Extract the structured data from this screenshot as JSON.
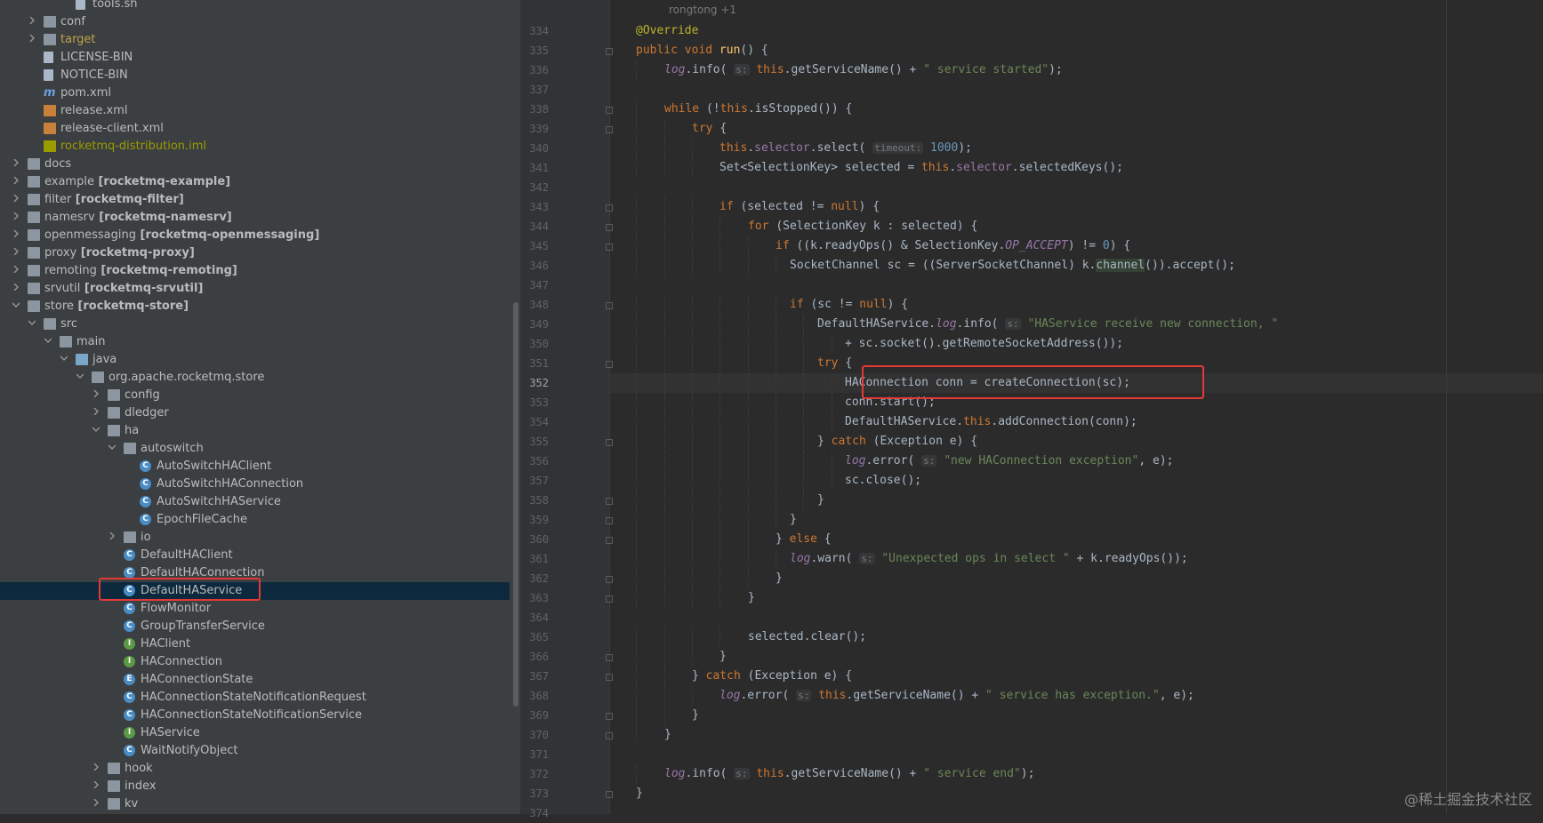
{
  "tree": [
    {
      "label": "tools.sh",
      "icon": "file-icon",
      "indent": 4,
      "arrow": "none"
    },
    {
      "label": "conf",
      "icon": "folder-icon",
      "indent": 2,
      "arrow": "collapsed"
    },
    {
      "label": "target",
      "icon": "folder-icon",
      "indent": 2,
      "arrow": "collapsed",
      "color": "orange"
    },
    {
      "label": "LICENSE-BIN",
      "icon": "file-icon",
      "indent": 2,
      "arrow": "none"
    },
    {
      "label": "NOTICE-BIN",
      "icon": "file-icon",
      "indent": 2,
      "arrow": "none"
    },
    {
      "label": "pom.xml",
      "icon": "maven-icon",
      "indent": 2,
      "arrow": "none"
    },
    {
      "label": "release.xml",
      "icon": "xml-icon",
      "indent": 2,
      "arrow": "none"
    },
    {
      "label": "release-client.xml",
      "icon": "xml-icon",
      "indent": 2,
      "arrow": "none"
    },
    {
      "label": "rocketmq-distribution.iml",
      "icon": "iml-icon",
      "indent": 2,
      "arrow": "none",
      "color": "olive"
    },
    {
      "label": "docs",
      "icon": "folder-icon",
      "indent": 1,
      "arrow": "collapsed"
    },
    {
      "label": "example",
      "module": "[rocketmq-example]",
      "icon": "module-folder-icon",
      "indent": 1,
      "arrow": "collapsed"
    },
    {
      "label": "filter",
      "module": "[rocketmq-filter]",
      "icon": "module-folder-icon",
      "indent": 1,
      "arrow": "collapsed"
    },
    {
      "label": "namesrv",
      "module": "[rocketmq-namesrv]",
      "icon": "module-folder-icon",
      "indent": 1,
      "arrow": "collapsed"
    },
    {
      "label": "openmessaging",
      "module": "[rocketmq-openmessaging]",
      "icon": "module-folder-icon",
      "indent": 1,
      "arrow": "collapsed"
    },
    {
      "label": "proxy",
      "module": "[rocketmq-proxy]",
      "icon": "module-folder-icon",
      "indent": 1,
      "arrow": "collapsed"
    },
    {
      "label": "remoting",
      "module": "[rocketmq-remoting]",
      "icon": "module-folder-icon",
      "indent": 1,
      "arrow": "collapsed"
    },
    {
      "label": "srvutil",
      "module": "[rocketmq-srvutil]",
      "icon": "module-folder-icon",
      "indent": 1,
      "arrow": "collapsed"
    },
    {
      "label": "store",
      "module": "[rocketmq-store]",
      "icon": "module-folder-icon",
      "indent": 1,
      "arrow": "expanded"
    },
    {
      "label": "src",
      "icon": "folder-icon",
      "indent": 2,
      "arrow": "expanded"
    },
    {
      "label": "main",
      "icon": "folder-icon",
      "indent": 3,
      "arrow": "expanded"
    },
    {
      "label": "java",
      "icon": "source-folder-icon",
      "indent": 4,
      "arrow": "expanded"
    },
    {
      "label": "org.apache.rocketmq.store",
      "icon": "package-icon",
      "indent": 5,
      "arrow": "expanded"
    },
    {
      "label": "config",
      "icon": "package-icon",
      "indent": 6,
      "arrow": "collapsed"
    },
    {
      "label": "dledger",
      "icon": "package-icon",
      "indent": 6,
      "arrow": "collapsed"
    },
    {
      "label": "ha",
      "icon": "package-icon",
      "indent": 6,
      "arrow": "expanded"
    },
    {
      "label": "autoswitch",
      "icon": "package-icon",
      "indent": 7,
      "arrow": "expanded"
    },
    {
      "label": "AutoSwitchHAClient",
      "icon": "class-icon",
      "indent": 8,
      "arrow": "none"
    },
    {
      "label": "AutoSwitchHAConnection",
      "icon": "class-icon",
      "indent": 8,
      "arrow": "none"
    },
    {
      "label": "AutoSwitchHAService",
      "icon": "class-icon",
      "indent": 8,
      "arrow": "none"
    },
    {
      "label": "EpochFileCache",
      "icon": "class-icon",
      "indent": 8,
      "arrow": "none"
    },
    {
      "label": "io",
      "icon": "package-icon",
      "indent": 7,
      "arrow": "collapsed"
    },
    {
      "label": "DefaultHAClient",
      "icon": "class-icon",
      "indent": 7,
      "arrow": "none"
    },
    {
      "label": "DefaultHAConnection",
      "icon": "class-icon",
      "indent": 7,
      "arrow": "none"
    },
    {
      "label": "DefaultHAService",
      "icon": "class-icon",
      "indent": 7,
      "arrow": "none",
      "selected": true
    },
    {
      "label": "FlowMonitor",
      "icon": "class-icon",
      "indent": 7,
      "arrow": "none"
    },
    {
      "label": "GroupTransferService",
      "icon": "class-icon",
      "indent": 7,
      "arrow": "none"
    },
    {
      "label": "HAClient",
      "icon": "interface-icon",
      "indent": 7,
      "arrow": "none"
    },
    {
      "label": "HAConnection",
      "icon": "interface-icon",
      "indent": 7,
      "arrow": "none"
    },
    {
      "label": "HAConnectionState",
      "icon": "enum-icon",
      "indent": 7,
      "arrow": "none"
    },
    {
      "label": "HAConnectionStateNotificationRequest",
      "icon": "class-icon",
      "indent": 7,
      "arrow": "none"
    },
    {
      "label": "HAConnectionStateNotificationService",
      "icon": "class-icon",
      "indent": 7,
      "arrow": "none"
    },
    {
      "label": "HAService",
      "icon": "interface-icon",
      "indent": 7,
      "arrow": "none"
    },
    {
      "label": "WaitNotifyObject",
      "icon": "class-icon",
      "indent": 7,
      "arrow": "none"
    },
    {
      "label": "hook",
      "icon": "package-icon",
      "indent": 6,
      "arrow": "collapsed"
    },
    {
      "label": "index",
      "icon": "package-icon",
      "indent": 6,
      "arrow": "collapsed"
    },
    {
      "label": "kv",
      "icon": "package-icon",
      "indent": 6,
      "arrow": "collapsed"
    }
  ],
  "editor": {
    "author_hint": "rongtong +1",
    "current_line": 352,
    "lines": [
      {
        "n": 334,
        "indent": 1,
        "t": [
          {
            "c": "ann",
            "s": "@Override"
          }
        ]
      },
      {
        "n": 335,
        "indent": 1,
        "t": [
          {
            "c": "kw",
            "s": "public void "
          },
          {
            "c": "fn",
            "s": "run"
          },
          {
            "s": "() {"
          }
        ]
      },
      {
        "n": 336,
        "indent": 2,
        "t": [
          {
            "c": "ifield",
            "s": "log"
          },
          {
            "s": ".info( "
          },
          {
            "c": "hint",
            "s": "s:"
          },
          {
            "s": " "
          },
          {
            "c": "kw",
            "s": "this"
          },
          {
            "s": ".getServiceName() + "
          },
          {
            "c": "str",
            "s": "\" service started\""
          },
          {
            "s": ");"
          }
        ]
      },
      {
        "n": 337,
        "indent": 0,
        "t": []
      },
      {
        "n": 338,
        "indent": 2,
        "t": [
          {
            "c": "kw",
            "s": "while "
          },
          {
            "s": "(!"
          },
          {
            "c": "kw",
            "s": "this"
          },
          {
            "s": ".isStopped()) {"
          }
        ]
      },
      {
        "n": 339,
        "indent": 3,
        "t": [
          {
            "c": "kw",
            "s": "try "
          },
          {
            "s": "{"
          }
        ]
      },
      {
        "n": 340,
        "indent": 4,
        "t": [
          {
            "c": "kw",
            "s": "this"
          },
          {
            "s": "."
          },
          {
            "c": "field",
            "s": "selector"
          },
          {
            "s": ".select( "
          },
          {
            "c": "hint",
            "s": "timeout:"
          },
          {
            "s": " "
          },
          {
            "c": "num",
            "s": "1000"
          },
          {
            "s": ");"
          }
        ]
      },
      {
        "n": 341,
        "indent": 4,
        "t": [
          {
            "s": "Set<SelectionKey> selected = "
          },
          {
            "c": "kw",
            "s": "this"
          },
          {
            "s": "."
          },
          {
            "c": "field",
            "s": "selector"
          },
          {
            "s": ".selectedKeys();"
          }
        ]
      },
      {
        "n": 342,
        "indent": 0,
        "t": []
      },
      {
        "n": 343,
        "indent": 4,
        "t": [
          {
            "c": "kw",
            "s": "if "
          },
          {
            "s": "(selected != "
          },
          {
            "c": "kw",
            "s": "null"
          },
          {
            "s": ") {"
          }
        ]
      },
      {
        "n": 344,
        "indent": 5,
        "t": [
          {
            "c": "kw",
            "s": "for "
          },
          {
            "s": "(SelectionKey k : selected) {"
          }
        ]
      },
      {
        "n": 345,
        "indent": 6,
        "t": [
          {
            "c": "kw",
            "s": "if "
          },
          {
            "s": "((k.readyOps() & SelectionKey."
          },
          {
            "c": "ifield",
            "s": "OP_ACCEPT"
          },
          {
            "s": ") != "
          },
          {
            "c": "num",
            "s": "0"
          },
          {
            "s": ") {"
          }
        ]
      },
      {
        "n": 346,
        "indent": 6,
        "extra": 1,
        "t": [
          {
            "s": "SocketChannel sc = ((ServerSocketChannel) k."
          },
          {
            "c": "hl",
            "s": "channel"
          },
          {
            "s": "()).accept();"
          }
        ]
      },
      {
        "n": 347,
        "indent": 0,
        "t": []
      },
      {
        "n": 348,
        "indent": 6,
        "extra": 1,
        "t": [
          {
            "c": "kw",
            "s": "if "
          },
          {
            "s": "(sc != "
          },
          {
            "c": "kw",
            "s": "null"
          },
          {
            "s": ") {"
          }
        ]
      },
      {
        "n": 349,
        "indent": 7,
        "extra": 1,
        "t": [
          {
            "s": "DefaultHAService."
          },
          {
            "c": "ifield",
            "s": "log"
          },
          {
            "s": ".info( "
          },
          {
            "c": "hint",
            "s": "s:"
          },
          {
            "s": " "
          },
          {
            "c": "str",
            "s": "\"HAService receive new connection, \""
          }
        ]
      },
      {
        "n": 350,
        "indent": 8,
        "extra": 1,
        "t": [
          {
            "s": "+ sc.socket().getRemoteSocketAddress());"
          }
        ]
      },
      {
        "n": 351,
        "indent": 7,
        "extra": 1,
        "t": [
          {
            "c": "kw",
            "s": "try "
          },
          {
            "s": "{"
          }
        ]
      },
      {
        "n": 352,
        "indent": 8,
        "extra": 1,
        "t": [
          {
            "s": "HAConnection conn = createConnection(sc);"
          }
        ]
      },
      {
        "n": 353,
        "indent": 8,
        "extra": 1,
        "t": [
          {
            "s": "conn.start();"
          }
        ]
      },
      {
        "n": 354,
        "indent": 8,
        "extra": 1,
        "t": [
          {
            "s": "DefaultHAService."
          },
          {
            "c": "kw",
            "s": "this"
          },
          {
            "s": ".addConnection(conn);"
          }
        ]
      },
      {
        "n": 355,
        "indent": 7,
        "extra": 1,
        "t": [
          {
            "s": "} "
          },
          {
            "c": "kw",
            "s": "catch "
          },
          {
            "s": "(Exception e) {"
          }
        ]
      },
      {
        "n": 356,
        "indent": 8,
        "extra": 1,
        "t": [
          {
            "c": "ifield",
            "s": "log"
          },
          {
            "s": ".error( "
          },
          {
            "c": "hint",
            "s": "s:"
          },
          {
            "s": " "
          },
          {
            "c": "str",
            "s": "\"new HAConnection exception\""
          },
          {
            "s": ", e);"
          }
        ]
      },
      {
        "n": 357,
        "indent": 8,
        "extra": 1,
        "t": [
          {
            "s": "sc.close();"
          }
        ]
      },
      {
        "n": 358,
        "indent": 7,
        "extra": 1,
        "t": [
          {
            "s": "}"
          }
        ]
      },
      {
        "n": 359,
        "indent": 6,
        "extra": 1,
        "t": [
          {
            "s": "}"
          }
        ]
      },
      {
        "n": 360,
        "indent": 6,
        "t": [
          {
            "s": "} "
          },
          {
            "c": "kw",
            "s": "else "
          },
          {
            "s": "{"
          }
        ]
      },
      {
        "n": 361,
        "indent": 6,
        "extra": 1,
        "t": [
          {
            "c": "ifield",
            "s": "log"
          },
          {
            "s": ".warn( "
          },
          {
            "c": "hint",
            "s": "s:"
          },
          {
            "s": " "
          },
          {
            "c": "str",
            "s": "\"Unexpected ops in select \""
          },
          {
            "s": " + k.readyOps());"
          }
        ]
      },
      {
        "n": 362,
        "indent": 6,
        "t": [
          {
            "s": "}"
          }
        ]
      },
      {
        "n": 363,
        "indent": 5,
        "t": [
          {
            "s": "}"
          }
        ]
      },
      {
        "n": 364,
        "indent": 0,
        "t": []
      },
      {
        "n": 365,
        "indent": 5,
        "t": [
          {
            "s": "selected.clear();"
          }
        ]
      },
      {
        "n": 366,
        "indent": 4,
        "t": [
          {
            "s": "}"
          }
        ]
      },
      {
        "n": 367,
        "indent": 3,
        "t": [
          {
            "s": "} "
          },
          {
            "c": "kw",
            "s": "catch "
          },
          {
            "s": "(Exception e) {"
          }
        ]
      },
      {
        "n": 368,
        "indent": 4,
        "t": [
          {
            "c": "ifield",
            "s": "log"
          },
          {
            "s": ".error( "
          },
          {
            "c": "hint",
            "s": "s:"
          },
          {
            "s": " "
          },
          {
            "c": "kw",
            "s": "this"
          },
          {
            "s": ".getServiceName() + "
          },
          {
            "c": "str",
            "s": "\" service has exception.\""
          },
          {
            "s": ", e);"
          }
        ]
      },
      {
        "n": 369,
        "indent": 3,
        "t": [
          {
            "s": "}"
          }
        ]
      },
      {
        "n": 370,
        "indent": 2,
        "t": [
          {
            "s": "}"
          }
        ]
      },
      {
        "n": 371,
        "indent": 0,
        "t": []
      },
      {
        "n": 372,
        "indent": 2,
        "t": [
          {
            "c": "ifield",
            "s": "log"
          },
          {
            "s": ".info( "
          },
          {
            "c": "hint",
            "s": "s:"
          },
          {
            "s": " "
          },
          {
            "c": "kw",
            "s": "this"
          },
          {
            "s": ".getServiceName() + "
          },
          {
            "c": "str",
            "s": "\" service end\""
          },
          {
            "s": ");"
          }
        ]
      },
      {
        "n": 373,
        "indent": 1,
        "t": [
          {
            "s": "}"
          }
        ]
      },
      {
        "n": 374,
        "indent": 0,
        "t": []
      }
    ]
  },
  "watermark": "@稀土掘金技术社区"
}
